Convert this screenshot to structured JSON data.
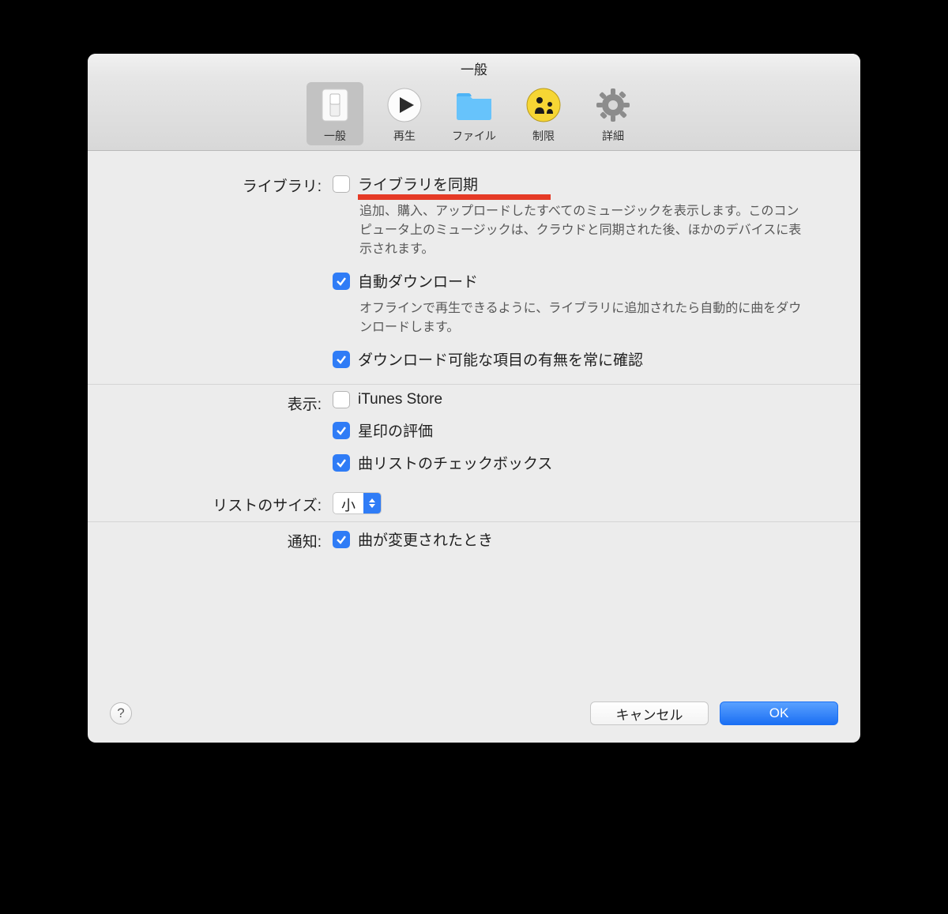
{
  "window": {
    "title": "一般"
  },
  "toolbar": {
    "items": [
      {
        "label": "一般",
        "selected": true
      },
      {
        "label": "再生"
      },
      {
        "label": "ファイル"
      },
      {
        "label": "制限"
      },
      {
        "label": "詳細"
      }
    ]
  },
  "sections": {
    "library": {
      "label": "ライブラリ:",
      "sync": {
        "label": "ライブラリを同期",
        "checked": false,
        "desc": "追加、購入、アップロードしたすべてのミュージックを表示します。このコンピュータ上のミュージックは、クラウドと同期された後、ほかのデバイスに表示されます。"
      },
      "autodl": {
        "label": "自動ダウンロード",
        "checked": true,
        "desc": "オフラインで再生できるように、ライブラリに追加されたら自動的に曲をダウンロードします。"
      },
      "checkdl": {
        "label": "ダウンロード可能な項目の有無を常に確認",
        "checked": true
      }
    },
    "display": {
      "label": "表示:",
      "itunes": {
        "label": "iTunes Store",
        "checked": false
      },
      "star": {
        "label": "星印の評価",
        "checked": true
      },
      "listcb": {
        "label": "曲リストのチェックボックス",
        "checked": true
      }
    },
    "listsize": {
      "label": "リストのサイズ:",
      "value": "小"
    },
    "notify": {
      "label": "通知:",
      "songchange": {
        "label": "曲が変更されたとき",
        "checked": true
      }
    }
  },
  "footer": {
    "cancel": "キャンセル",
    "ok": "OK"
  }
}
